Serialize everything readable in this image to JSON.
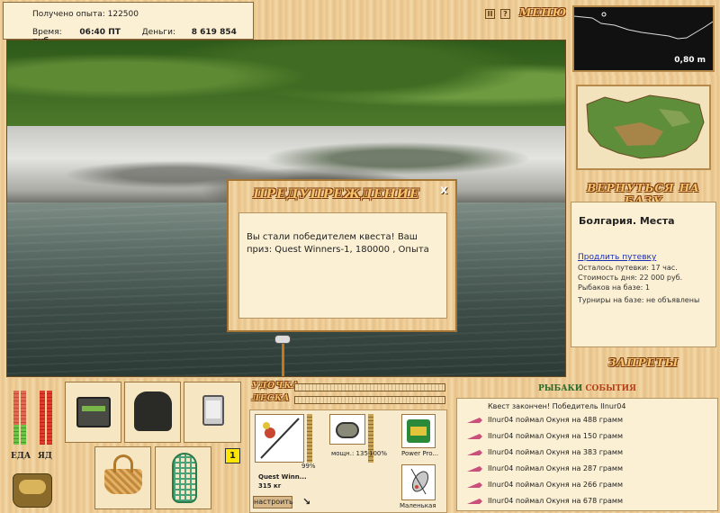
{
  "header": {
    "experience_label": "Получено опыта:",
    "experience_value": "122500",
    "time_label": "Время:",
    "time_value": "06:40 ПТ",
    "money_label": "Деньги:",
    "money_value": "8 619 854 руб."
  },
  "menubar": {
    "pause_label": "II",
    "help_label": "?",
    "menu_label": "МЕНЮ"
  },
  "depth": {
    "value": "0,80 m"
  },
  "right": {
    "back_to_base": "ВЕРНУТЬСЯ НА БАЗУ",
    "place_title": "Болгария. Места",
    "extend_link": "Продлить путевку",
    "remaining": "Осталось путевки: 17 час.",
    "day_cost": "Стоимость дня: 22 000 руб.",
    "fishers": "Рыбаков на базе: 1",
    "tournaments": "Турниры на базе: не объявлены",
    "bans": "ЗАПРЕТЫ"
  },
  "dialog": {
    "title": "ПРЕДУПРЕЖДЕНИЕ",
    "close": "x",
    "message": "Вы стали победителем квеста! Ваш приз: Quest Winners-1, 180000 , Опыта"
  },
  "bottom": {
    "food_label": "ЕДА",
    "poison_label": "ЯД",
    "badge": "1",
    "rod_label": "УДОЧКА",
    "line_label": "ЛЕСКА",
    "rod_name": "Quest Winn...",
    "rod_weight": "315 кг",
    "rod_percent": "99%",
    "reel_text": "мощн.: 135",
    "reel_percent": "100%",
    "line_item": "Power Pro...",
    "lure_item": "Маленькая",
    "setup_button": "настроить",
    "food_fill": 0.35,
    "poison_fill": 1.0
  },
  "events": {
    "title_a": "РЫБАКИ",
    "title_b": "СОБЫТИЯ",
    "items": [
      "Квест закончен! Победитель IInur04",
      "IInur04 поймал Окуня на 488 грамм",
      "IInur04 поймал Окуня на 150 грамм",
      "IInur04 поймал Окуня на 383 грамм",
      "IInur04 поймал Окуня на 287 грамм",
      "IInur04 поймал Окуня на 266 грамм",
      "IInur04 поймал Окуня на 678 грамм"
    ]
  }
}
